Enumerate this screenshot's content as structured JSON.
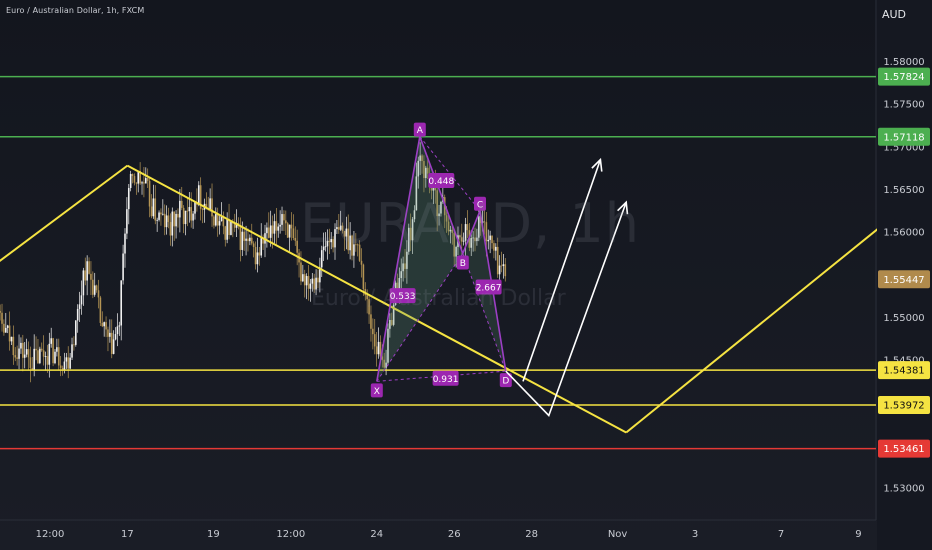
{
  "header": {
    "symbol_title": "Euro / Australian Dollar, 1h, FXCM",
    "currency": "AUD"
  },
  "watermark": {
    "ticker": "EURAUD, 1h",
    "name": "Euro / Australian Dollar"
  },
  "chart_data": {
    "type": "candlestick",
    "symbol": "EURAUD",
    "timeframe": "1h",
    "y_range": [
      1.528,
      1.583
    ],
    "y_ticks": [
      1.53,
      1.535,
      1.54,
      1.545,
      1.55,
      1.555,
      1.56,
      1.565,
      1.57,
      1.575,
      1.58
    ],
    "y_tick_labels": [
      "1.53000",
      "",
      "",
      "1.54500",
      "1.55000",
      "",
      "1.56000",
      "1.56500",
      "1.57000",
      "1.57500",
      "1.58000"
    ],
    "x_ticks": [
      {
        "label": "12:00",
        "x": 0
      },
      {
        "label": "17",
        "x": 9
      },
      {
        "label": "19",
        "x": 19
      },
      {
        "label": "12:00",
        "x": 28
      },
      {
        "label": "24",
        "x": 38
      },
      {
        "label": "26",
        "x": 47
      },
      {
        "label": "28",
        "x": 56
      },
      {
        "label": "Nov",
        "x": 66
      },
      {
        "label": "3",
        "x": 75
      },
      {
        "label": "7",
        "x": 85
      },
      {
        "label": "9",
        "x": 94
      }
    ],
    "horizontal_levels": [
      {
        "price": 1.57824,
        "label": "1.57824",
        "color": "#4caf50"
      },
      {
        "price": 1.57118,
        "label": "1.57118",
        "color": "#4caf50"
      },
      {
        "price": 1.54381,
        "label": "1.54381",
        "color": "#f5e342"
      },
      {
        "price": 1.53972,
        "label": "1.53972",
        "color": "#f5e342"
      },
      {
        "price": 1.53461,
        "label": "1.53461",
        "color": "#e53935"
      }
    ],
    "last_price": {
      "price": 1.55447,
      "label": "1.55447",
      "color": "#b08a4c"
    },
    "close_path": [
      [
        -8,
        1.5515
      ],
      [
        -6,
        1.5495
      ],
      [
        -4,
        1.5465
      ],
      [
        -2,
        1.545
      ],
      [
        0,
        1.5462
      ],
      [
        2,
        1.5448
      ],
      [
        3,
        1.549
      ],
      [
        4,
        1.556
      ],
      [
        5,
        1.554
      ],
      [
        6,
        1.549
      ],
      [
        7,
        1.5465
      ],
      [
        8,
        1.5485
      ],
      [
        9,
        1.5645
      ],
      [
        10,
        1.5665
      ],
      [
        11,
        1.5655
      ],
      [
        12,
        1.5625
      ],
      [
        13,
        1.5615
      ],
      [
        14,
        1.5605
      ],
      [
        15,
        1.5625
      ],
      [
        16,
        1.5615
      ],
      [
        17,
        1.5645
      ],
      [
        18,
        1.5635
      ],
      [
        19,
        1.562
      ],
      [
        20,
        1.5605
      ],
      [
        21,
        1.5605
      ],
      [
        22,
        1.5595
      ],
      [
        23,
        1.5585
      ],
      [
        24,
        1.557
      ],
      [
        25,
        1.5595
      ],
      [
        26,
        1.5595
      ],
      [
        27,
        1.5625
      ],
      [
        28,
        1.5595
      ],
      [
        29,
        1.5555
      ],
      [
        30,
        1.5545
      ],
      [
        31,
        1.555
      ],
      [
        32,
        1.5585
      ],
      [
        33,
        1.5595
      ],
      [
        34,
        1.56
      ],
      [
        35,
        1.559
      ],
      [
        36,
        1.5575
      ],
      [
        37,
        1.5505
      ],
      [
        38,
        1.5465
      ],
      [
        39,
        1.545
      ],
      [
        40,
        1.5525
      ],
      [
        41,
        1.5555
      ],
      [
        42,
        1.5605
      ],
      [
        43,
        1.5685
      ],
      [
        44,
        1.5665
      ],
      [
        45,
        1.5635
      ],
      [
        46,
        1.5625
      ],
      [
        47,
        1.5575
      ],
      [
        48,
        1.5605
      ],
      [
        49,
        1.559
      ],
      [
        50,
        1.5615
      ],
      [
        51,
        1.5595
      ],
      [
        52,
        1.5565
      ],
      [
        53,
        1.555
      ]
    ],
    "harmonic_pattern": {
      "points": [
        {
          "label": "X",
          "x": 38,
          "price": 1.5425
        },
        {
          "label": "A",
          "x": 43,
          "price": 1.5712
        },
        {
          "label": "B",
          "x": 48,
          "price": 1.5575
        },
        {
          "label": "C",
          "x": 50,
          "price": 1.5625
        },
        {
          "label": "D",
          "x": 53,
          "price": 1.5437
        }
      ],
      "ratios": [
        {
          "label": "0.448",
          "x": 45.5,
          "price": 1.566
        },
        {
          "label": "0.533",
          "x": 41,
          "price": 1.5525
        },
        {
          "label": "2.667",
          "x": 51,
          "price": 1.5535
        },
        {
          "label": "0.931",
          "x": 46,
          "price": 1.5428
        }
      ]
    },
    "trendlines": [
      {
        "from": [
          -6,
          1.5565
        ],
        "to": [
          9,
          1.5678
        ]
      },
      {
        "from": [
          9,
          1.5678
        ],
        "to": [
          67,
          1.5365
        ]
      },
      {
        "from": [
          67,
          1.5365
        ],
        "to": [
          98,
          1.5618
        ]
      }
    ],
    "projections": [
      [
        [
          53,
          1.5437
        ],
        [
          58,
          1.5385
        ],
        [
          67,
          1.5635
        ]
      ],
      [
        [
          55,
          1.5425
        ],
        [
          64,
          1.5685
        ]
      ]
    ]
  }
}
